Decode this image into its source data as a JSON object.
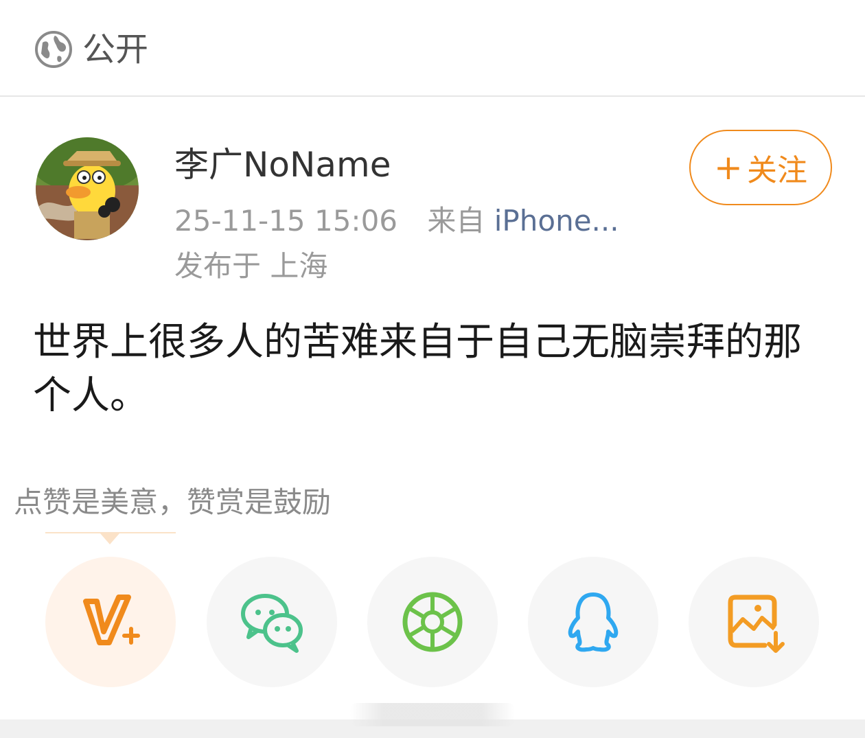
{
  "visibility": {
    "label": "公开",
    "icon": "globe-icon"
  },
  "author": {
    "name": "李广NoName",
    "avatar": "duck-explorer-avatar",
    "time": "25-11-15 15:06",
    "source_prefix": "来自",
    "source": "iPhone...",
    "location": "发布于 上海"
  },
  "follow": {
    "plus": "+",
    "label": "关注",
    "color": "#f08a1c"
  },
  "post": {
    "text": "世界上很多人的苦难来自于自己无脑崇拜的那个人。"
  },
  "reward": {
    "hint": "点赞是美意，赞赏是鼓励"
  },
  "share": [
    {
      "name": "reward",
      "icon": "v-plus-icon",
      "color": "#f08a1c"
    },
    {
      "name": "wechat",
      "icon": "wechat-icon",
      "color": "#4cc28b"
    },
    {
      "name": "moments",
      "icon": "aperture-icon",
      "color": "#6cc24a"
    },
    {
      "name": "qq",
      "icon": "penguin-icon",
      "color": "#2fa8f0"
    },
    {
      "name": "save-image",
      "icon": "save-image-icon",
      "color": "#f39c24"
    }
  ]
}
